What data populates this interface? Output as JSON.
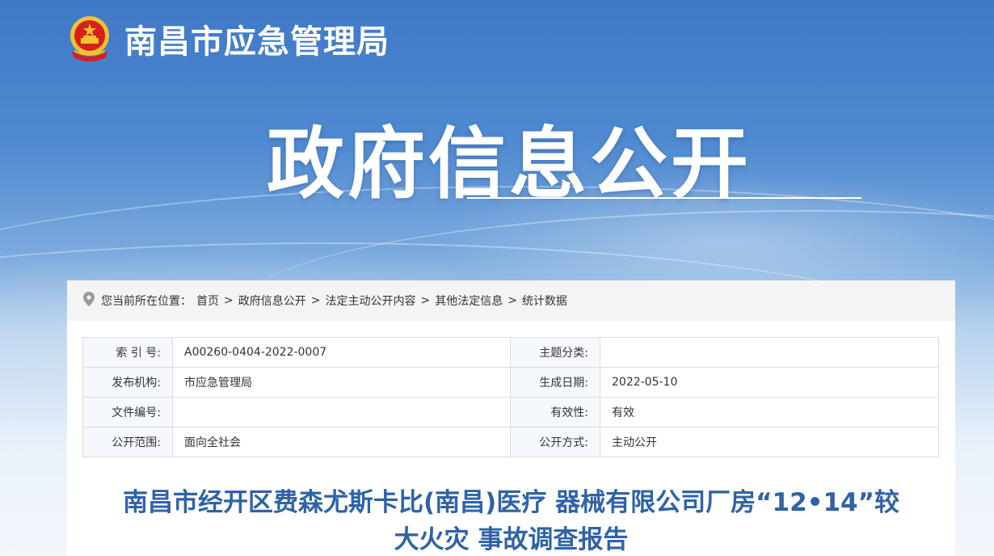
{
  "site": {
    "title": "南昌市应急管理局"
  },
  "hero": {
    "title": "政府信息公开"
  },
  "breadcrumb": {
    "prefix": "您当前所在位置：",
    "items": [
      "首页",
      "政府信息公开",
      "法定主动公开内容",
      "其他法定信息",
      "统计数据"
    ],
    "separator": ">"
  },
  "meta": {
    "rows": [
      {
        "l1": "索 引 号:",
        "v1": "A00260-0404-2022-0007",
        "l2": "主题分类:",
        "v2": ""
      },
      {
        "l1": "发布机构:",
        "v1": "市应急管理局",
        "l2": "生成日期:",
        "v2": "2022-05-10"
      },
      {
        "l1": "文件编号:",
        "v1": "",
        "l2": "有效性:",
        "v2": "有效"
      },
      {
        "l1": "公开范围:",
        "v1": "面向全社会",
        "l2": "公开方式:",
        "v2": "主动公开"
      }
    ]
  },
  "article": {
    "title_line1": "南昌市经开区费森尤斯卡比(南昌)医疗 器械有限公司厂房“12•14”较",
    "title_line2": "大火灾 事故调查报告"
  },
  "colors": {
    "accent": "#2f63a8",
    "emblem_red": "#d6201c",
    "emblem_gold": "#f2c230"
  }
}
